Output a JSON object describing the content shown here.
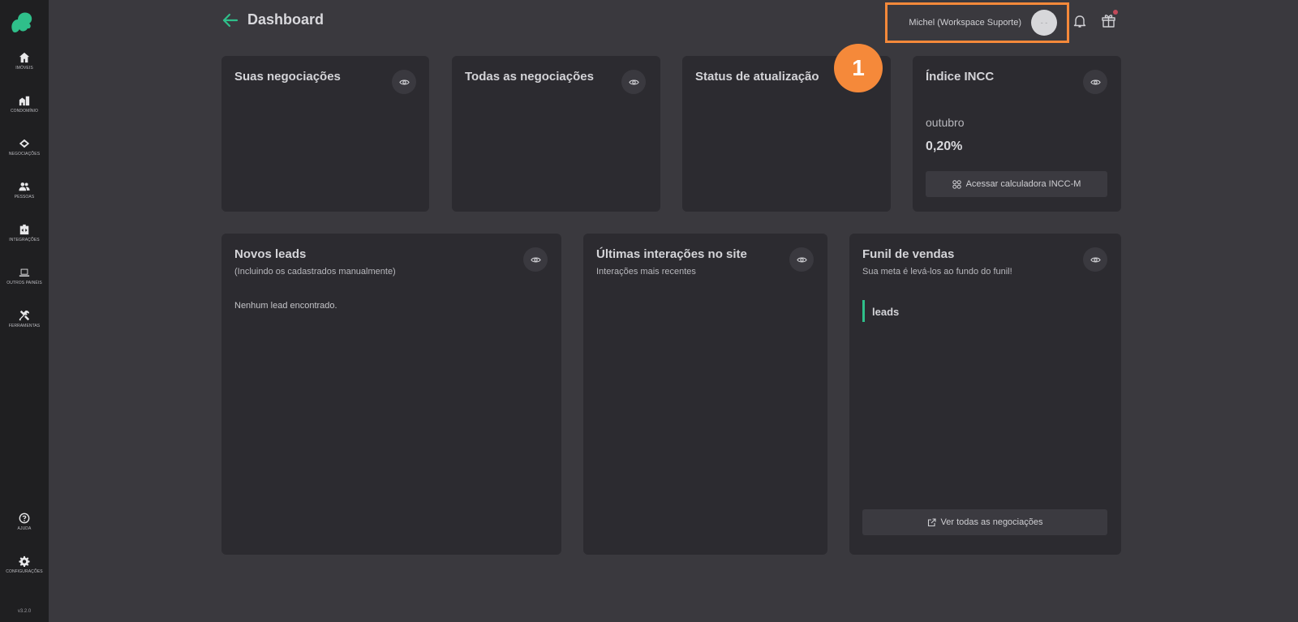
{
  "sidebar": {
    "items": [
      {
        "label": "IMÓVEIS",
        "icon": "home-icon"
      },
      {
        "label": "CONDOMÍNIO",
        "icon": "building-icon"
      },
      {
        "label": "NEGOCIAÇÕES",
        "icon": "handshake-icon"
      },
      {
        "label": "PESSOAS",
        "icon": "people-icon"
      },
      {
        "label": "INTEGRAÇÕES",
        "icon": "integrations-icon"
      },
      {
        "label": "OUTROS PAINÉIS",
        "icon": "laptop-icon"
      },
      {
        "label": "FERRAMENTAS",
        "icon": "tools-icon"
      }
    ],
    "bottom": [
      {
        "label": "AJUDA",
        "icon": "help-icon"
      },
      {
        "label": "CONFIGURAÇÕES",
        "icon": "gear-icon"
      }
    ],
    "version": "v3.2.0"
  },
  "header": {
    "title": "Dashboard",
    "user_name": "Michel (Workspace Suporte)",
    "avatar_text": "- -"
  },
  "annotation": {
    "step": "1",
    "color": "#f5893a"
  },
  "cards": {
    "suas": {
      "title": "Suas negociações"
    },
    "todas": {
      "title": "Todas as negociações"
    },
    "status": {
      "title": "Status de atualização"
    },
    "incc": {
      "title": "Índice INCC",
      "month": "outubro",
      "value": "0,20%",
      "button": "Acessar calculadora INCC-M"
    },
    "leads": {
      "title": "Novos leads",
      "subtitle": "(Incluindo os cadastrados manualmente)",
      "empty": "Nenhum lead encontrado."
    },
    "interacoes": {
      "title": "Últimas interações no site",
      "subtitle": "Interações mais recentes"
    },
    "funil": {
      "title": "Funil de vendas",
      "subtitle": "Sua meta é levá-los ao fundo do funil!",
      "stage": "leads",
      "button": "Ver todas as negociações"
    }
  },
  "colors": {
    "accent": "#2fbf8a",
    "highlight": "#f5893a",
    "background": "#3a393e",
    "card": "#2c2b30",
    "sidebar": "#1f1f21"
  }
}
